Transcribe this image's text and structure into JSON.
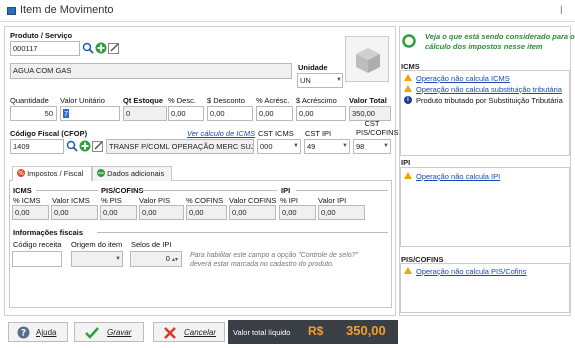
{
  "window": {
    "title": "Item de Movimento",
    "close_glyph": "ꟾ"
  },
  "produto": {
    "label": "Produto / Serviço",
    "code": "000117",
    "description": "AGUA COM GAS",
    "unidade_label": "Unidade",
    "unidade_value": "UN"
  },
  "values_row": {
    "quantidade_label": "Quantidade",
    "quantidade": "50",
    "valor_unitario_label": "Valor Unitário",
    "valor_unitario": "7",
    "qt_estoque_label": "Qt Estoque",
    "qt_estoque": "0",
    "pct_desc_label": "% Desc.",
    "pct_desc": "0,00",
    "desconto_label": "$ Desconto",
    "desconto": "0,00",
    "pct_acresc_label": "% Acrésc.",
    "pct_acresc": "0,00",
    "acrescimo_label": "$ Acréscimo",
    "acrescimo": "0,00",
    "valor_total_label": "Valor Total",
    "valor_total": "350,00"
  },
  "cfop": {
    "label": "Código Fiscal (CFOP)",
    "ver_calculo_link": "Ver cálculo de ICMS",
    "code": "1409",
    "description": "TRANSF P/COML OPERAÇÃO MERC SUJ SUB TRIB",
    "cst_icms_label": "CST ICMS",
    "cst_icms": "000",
    "cst_ipi_label": "CST IPI",
    "cst_ipi": "49",
    "cst_pis_label": "CST\nPIS/COFINS",
    "cst_pis_line1": "CST",
    "cst_pis_line2": "PIS/COFINS",
    "cst_pis": "98"
  },
  "tabs": [
    {
      "label": "Impostos / Fiscal",
      "active": true
    },
    {
      "label": "Dados adicionais",
      "active": false
    }
  ],
  "taxes": {
    "icms_group": "ICMS",
    "pis_group": "PIS/COFINS",
    "ipi_group": "IPI",
    "headers": [
      "% ICMS",
      "Valor ICMS",
      "% PIS",
      "Valor PIS",
      "% COFINS",
      "Valor COFINS",
      "% IPI",
      "Valor IPI"
    ],
    "values": [
      "0,00",
      "0,00",
      "0,00",
      "0,00",
      "0,00",
      "0,00",
      "0,00",
      "0,00"
    ]
  },
  "info_fiscais": {
    "title": "Informações fiscais",
    "codigo_receita_label": "Código receita",
    "origem_label": "Origem do item",
    "selos_label": "Selos de IPI",
    "selos_value": "0",
    "note": "Para habilitar este campo a opção \"Controle de selo?\" deverá estar marcada no cadastro do produto.",
    "note_line1": "Para habilitar este campo a opção \"Controle de selo?\"",
    "note_line2": "deverá estar marcada no cadastro do produto."
  },
  "right_panel": {
    "headline_line1": "Veja o que está sendo considerado para o",
    "headline_line2": "cálculo dos impostos nesse item",
    "icms_title": "ICMS",
    "icms_items": [
      {
        "kind": "warning",
        "text": "Operação não calcula ICMS"
      },
      {
        "kind": "warning",
        "text": "Operação não calcula substituição tributária"
      },
      {
        "kind": "info",
        "text": "Produto tributado por Substituição Tributária"
      }
    ],
    "ipi_title": "IPI",
    "ipi_items": [
      {
        "kind": "warning",
        "text": "Operação não calcula IPI"
      }
    ],
    "pis_title": "PIS/COFINS",
    "pis_items": [
      {
        "kind": "warning",
        "text": "Operação não calcula PIS/Cofins"
      }
    ]
  },
  "footer": {
    "ajuda": "Ajuda",
    "gravar": "Gravar",
    "cancelar": "Cancelar",
    "total_label": "Valor total líquido",
    "currency": "R$",
    "total_value": "350,00"
  },
  "colors": {
    "accent_green": "#2f9e3a",
    "footer_dark": "#3a3f45",
    "total_orange": "#f0a030",
    "link_blue": "#1a47b8",
    "warn_yellow": "#f0a500"
  }
}
